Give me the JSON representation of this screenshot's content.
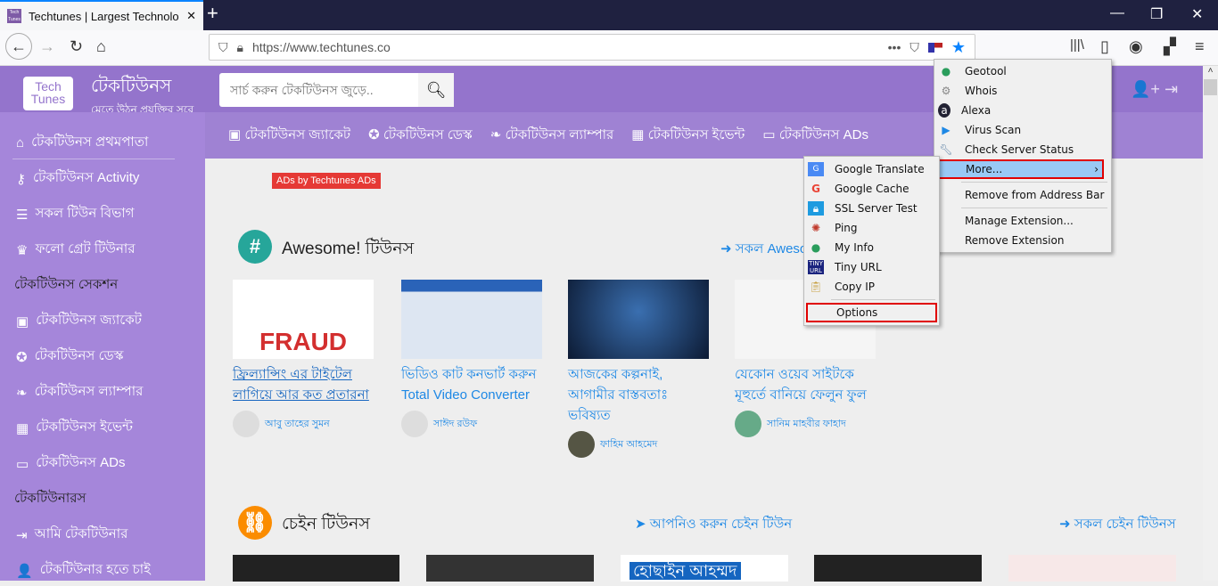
{
  "browser": {
    "tab_title": "Techtunes | Largest Technology",
    "url": "https://www.techtunes.co",
    "new_tab": "+"
  },
  "site": {
    "logo_text": "Tech Tunes",
    "brand": "টেকটিউনস",
    "tagline": "মেতে উঠুন প্রযুক্তির সুরে",
    "search_placeholder": "সার্চ করুন টেকটিউনস জুড়ে..",
    "topnav": [
      "টেকটিউনস জ্যাকেট",
      "টেকটিউনস ডেস্ক",
      "টেকটিউনস ল্যাম্পার",
      "টেকটিউনস ইভেন্ট",
      "টেকটিউনস ADs"
    ],
    "ad_tag": "ADs by Techtunes ADs"
  },
  "sidebar": {
    "items": [
      "টেকটিউনস প্রথমপাতা",
      "টেকটিউনস Activity",
      "সকল টিউন বিভাগ",
      "ফলো গ্রেট টিউনার"
    ],
    "section1": "টেকটিউনস সেকশন",
    "items2": [
      "টেকটিউনস জ্যাকেট",
      "টেকটিউনস ডেস্ক",
      "টেকটিউনস ল্যাম্পার",
      "টেকটিউনস ইভেন্ট",
      "টেকটিউনস ADs"
    ],
    "section2": "টেকটিউনারস",
    "items3": [
      "আমি টেকটিউনার",
      "টেকটিউনার হতে চাই"
    ]
  },
  "awesome": {
    "title": "Awesome! টিউনস",
    "all_link": "সকল Awesome",
    "cards": [
      {
        "title": "ফ্রিল্যান্সিং এর টাইটেল লাগিয়ে আর কত প্রতারনা",
        "author": "আবু তাহের সুমন",
        "img_text": "FRAUD"
      },
      {
        "title": "ভিডিও কাট কনভার্ট করুন Total Video Converter",
        "author": "সাঈদ রউফ"
      },
      {
        "title": "আজকের কল্পনাই, আগামীর বাস্তবতাঃ ভবিষ্যত",
        "author": "ফাহিম আহমেদ"
      },
      {
        "title": "যেকোন ওয়েব সাইটকে মূহুর্তে বানিয়ে ফেলুন ফুল",
        "author": "সানিম মাহবীর ফাহাদ"
      }
    ]
  },
  "chain": {
    "title": "চেইন টিউনস",
    "join_link": "আপনিও করুন চেইন টিউন",
    "all_link": "সকল চেইন টিউনস",
    "card3_text": "হোছাইন আহম্মদ"
  },
  "context_menu": {
    "items": [
      "Geotool",
      "Whois",
      "Alexa",
      "Virus Scan",
      "Check Server Status"
    ],
    "more": "More...",
    "remove_bar": "Remove from Address Bar",
    "manage": "Manage Extension...",
    "remove_ext": "Remove Extension"
  },
  "submenu": {
    "items": [
      "Google Translate",
      "Google Cache",
      "SSL Server Test",
      "Ping",
      "My Info",
      "Tiny URL",
      "Copy IP"
    ],
    "options": "Options"
  },
  "colors": {
    "purple": "#9474cc",
    "link": "#1e88e5",
    "highlight_box": "#e00000"
  }
}
